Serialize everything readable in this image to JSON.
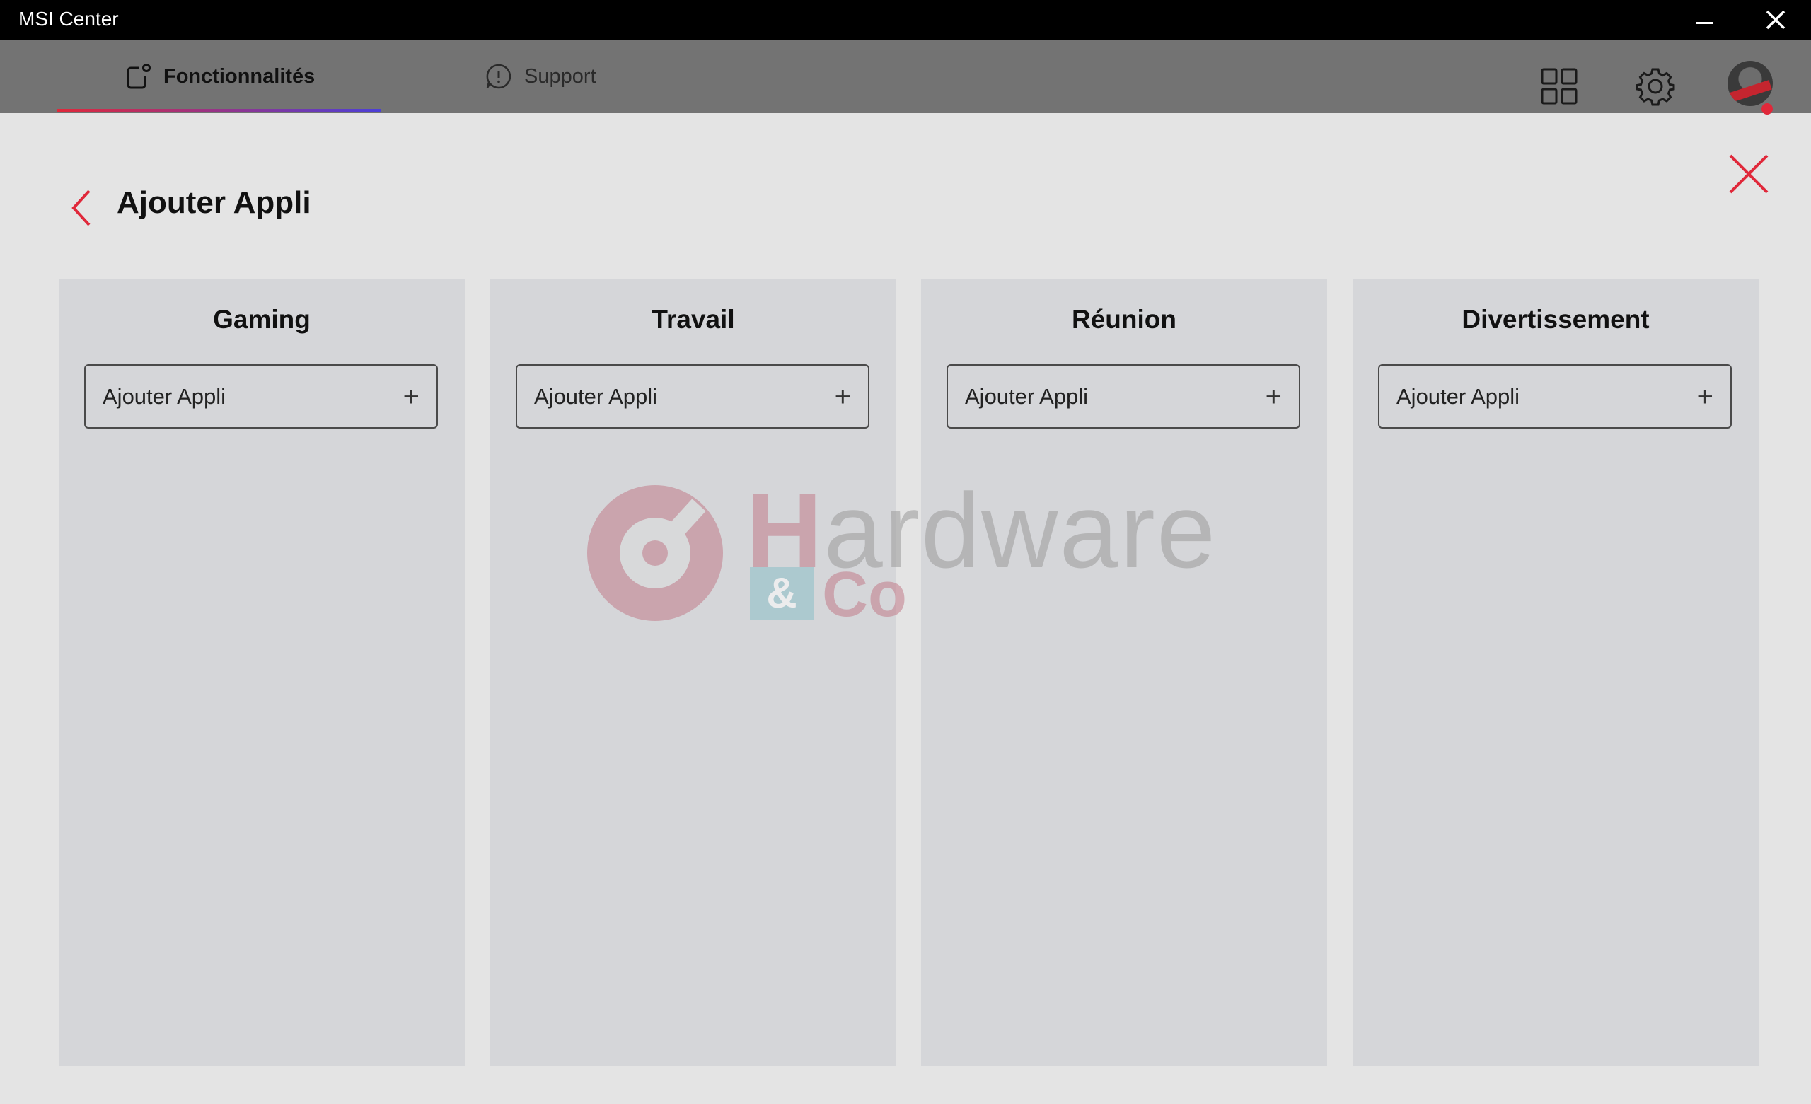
{
  "window": {
    "title": "MSI Center"
  },
  "nav": {
    "tabs": [
      {
        "label": "Fonctionnalités",
        "active": true,
        "icon": "features-icon"
      },
      {
        "label": "Support",
        "active": false,
        "icon": "chat-bubble-icon"
      }
    ],
    "icons": [
      "apps-grid-icon",
      "gear-icon",
      "avatar"
    ]
  },
  "page": {
    "title": "Ajouter Appli"
  },
  "columns": [
    {
      "title": "Gaming",
      "add_label": "Ajouter Appli"
    },
    {
      "title": "Travail",
      "add_label": "Ajouter Appli"
    },
    {
      "title": "Réunion",
      "add_label": "Ajouter Appli"
    },
    {
      "title": "Divertissement",
      "add_label": "Ajouter Appli"
    }
  ],
  "watermark": {
    "word": "ardware",
    "initial": "H",
    "amp": "&",
    "co": "Co"
  },
  "colors": {
    "accent": "#e0283a",
    "nav_bg": "#737373",
    "column_bg": "#d5d6d9",
    "page_bg": "#e4e4e4"
  }
}
